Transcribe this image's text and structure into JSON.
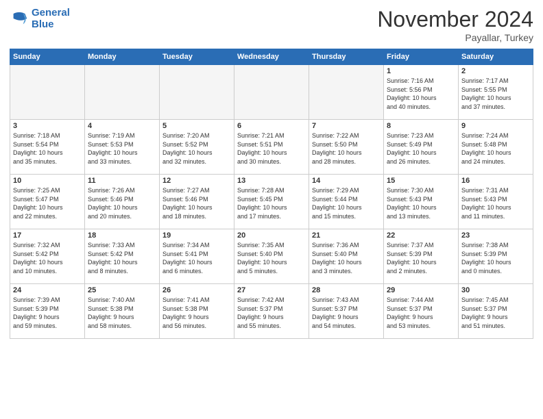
{
  "logo": {
    "line1": "General",
    "line2": "Blue"
  },
  "header": {
    "month": "November 2024",
    "location": "Payallar, Turkey"
  },
  "weekdays": [
    "Sunday",
    "Monday",
    "Tuesday",
    "Wednesday",
    "Thursday",
    "Friday",
    "Saturday"
  ],
  "weeks": [
    [
      {
        "day": "",
        "info": ""
      },
      {
        "day": "",
        "info": ""
      },
      {
        "day": "",
        "info": ""
      },
      {
        "day": "",
        "info": ""
      },
      {
        "day": "",
        "info": ""
      },
      {
        "day": "1",
        "info": "Sunrise: 7:16 AM\nSunset: 5:56 PM\nDaylight: 10 hours\nand 40 minutes."
      },
      {
        "day": "2",
        "info": "Sunrise: 7:17 AM\nSunset: 5:55 PM\nDaylight: 10 hours\nand 37 minutes."
      }
    ],
    [
      {
        "day": "3",
        "info": "Sunrise: 7:18 AM\nSunset: 5:54 PM\nDaylight: 10 hours\nand 35 minutes."
      },
      {
        "day": "4",
        "info": "Sunrise: 7:19 AM\nSunset: 5:53 PM\nDaylight: 10 hours\nand 33 minutes."
      },
      {
        "day": "5",
        "info": "Sunrise: 7:20 AM\nSunset: 5:52 PM\nDaylight: 10 hours\nand 32 minutes."
      },
      {
        "day": "6",
        "info": "Sunrise: 7:21 AM\nSunset: 5:51 PM\nDaylight: 10 hours\nand 30 minutes."
      },
      {
        "day": "7",
        "info": "Sunrise: 7:22 AM\nSunset: 5:50 PM\nDaylight: 10 hours\nand 28 minutes."
      },
      {
        "day": "8",
        "info": "Sunrise: 7:23 AM\nSunset: 5:49 PM\nDaylight: 10 hours\nand 26 minutes."
      },
      {
        "day": "9",
        "info": "Sunrise: 7:24 AM\nSunset: 5:48 PM\nDaylight: 10 hours\nand 24 minutes."
      }
    ],
    [
      {
        "day": "10",
        "info": "Sunrise: 7:25 AM\nSunset: 5:47 PM\nDaylight: 10 hours\nand 22 minutes."
      },
      {
        "day": "11",
        "info": "Sunrise: 7:26 AM\nSunset: 5:46 PM\nDaylight: 10 hours\nand 20 minutes."
      },
      {
        "day": "12",
        "info": "Sunrise: 7:27 AM\nSunset: 5:46 PM\nDaylight: 10 hours\nand 18 minutes."
      },
      {
        "day": "13",
        "info": "Sunrise: 7:28 AM\nSunset: 5:45 PM\nDaylight: 10 hours\nand 17 minutes."
      },
      {
        "day": "14",
        "info": "Sunrise: 7:29 AM\nSunset: 5:44 PM\nDaylight: 10 hours\nand 15 minutes."
      },
      {
        "day": "15",
        "info": "Sunrise: 7:30 AM\nSunset: 5:43 PM\nDaylight: 10 hours\nand 13 minutes."
      },
      {
        "day": "16",
        "info": "Sunrise: 7:31 AM\nSunset: 5:43 PM\nDaylight: 10 hours\nand 11 minutes."
      }
    ],
    [
      {
        "day": "17",
        "info": "Sunrise: 7:32 AM\nSunset: 5:42 PM\nDaylight: 10 hours\nand 10 minutes."
      },
      {
        "day": "18",
        "info": "Sunrise: 7:33 AM\nSunset: 5:42 PM\nDaylight: 10 hours\nand 8 minutes."
      },
      {
        "day": "19",
        "info": "Sunrise: 7:34 AM\nSunset: 5:41 PM\nDaylight: 10 hours\nand 6 minutes."
      },
      {
        "day": "20",
        "info": "Sunrise: 7:35 AM\nSunset: 5:40 PM\nDaylight: 10 hours\nand 5 minutes."
      },
      {
        "day": "21",
        "info": "Sunrise: 7:36 AM\nSunset: 5:40 PM\nDaylight: 10 hours\nand 3 minutes."
      },
      {
        "day": "22",
        "info": "Sunrise: 7:37 AM\nSunset: 5:39 PM\nDaylight: 10 hours\nand 2 minutes."
      },
      {
        "day": "23",
        "info": "Sunrise: 7:38 AM\nSunset: 5:39 PM\nDaylight: 10 hours\nand 0 minutes."
      }
    ],
    [
      {
        "day": "24",
        "info": "Sunrise: 7:39 AM\nSunset: 5:39 PM\nDaylight: 9 hours\nand 59 minutes."
      },
      {
        "day": "25",
        "info": "Sunrise: 7:40 AM\nSunset: 5:38 PM\nDaylight: 9 hours\nand 58 minutes."
      },
      {
        "day": "26",
        "info": "Sunrise: 7:41 AM\nSunset: 5:38 PM\nDaylight: 9 hours\nand 56 minutes."
      },
      {
        "day": "27",
        "info": "Sunrise: 7:42 AM\nSunset: 5:37 PM\nDaylight: 9 hours\nand 55 minutes."
      },
      {
        "day": "28",
        "info": "Sunrise: 7:43 AM\nSunset: 5:37 PM\nDaylight: 9 hours\nand 54 minutes."
      },
      {
        "day": "29",
        "info": "Sunrise: 7:44 AM\nSunset: 5:37 PM\nDaylight: 9 hours\nand 53 minutes."
      },
      {
        "day": "30",
        "info": "Sunrise: 7:45 AM\nSunset: 5:37 PM\nDaylight: 9 hours\nand 51 minutes."
      }
    ]
  ]
}
